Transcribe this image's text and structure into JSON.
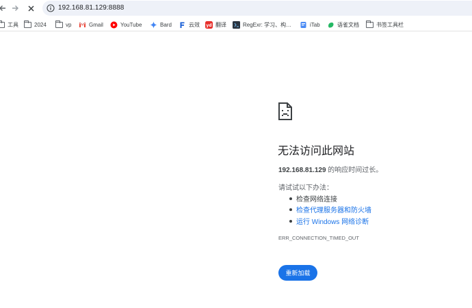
{
  "toolbar": {
    "back_icon": "arrow-back-icon",
    "forward_icon": "arrow-forward-icon",
    "stop_icon": "close-icon",
    "url": "192.168.81.129:8888"
  },
  "bookmarks": [
    {
      "label": "工具",
      "icon": "folder-icon"
    },
    {
      "label": "2024",
      "icon": "folder-icon"
    },
    {
      "label": "vp",
      "icon": "folder-icon"
    },
    {
      "label": "Gmail",
      "icon": "gmail-icon"
    },
    {
      "label": "YouTube",
      "icon": "youtube-icon"
    },
    {
      "label": "Bard",
      "icon": "bard-icon"
    },
    {
      "label": "云效",
      "icon": "yunxiao-icon"
    },
    {
      "label": "翻译",
      "icon": "youdao-icon"
    },
    {
      "label": "RegExr: 学习、构…",
      "icon": "regexr-icon"
    },
    {
      "label": "iTab",
      "icon": "itab-icon"
    },
    {
      "label": "语雀文档",
      "icon": "yuque-icon"
    },
    {
      "label": "书签工具栏",
      "icon": "folder-icon"
    }
  ],
  "error": {
    "icon": "sad-document-icon",
    "title": "无法访问此网站",
    "host": "192.168.81.129",
    "host_suffix": " 的响应时间过长。",
    "try_label": "请试试以下办法：",
    "suggestions": [
      "检查网络连接",
      "检查代理服务器和防火墙",
      "运行 Windows 网络诊断"
    ],
    "code": "ERR_CONNECTION_TIMED_OUT",
    "reload_label": "重新加载"
  },
  "colors": {
    "accent": "#1a73e8",
    "omnibox_bg": "#eef1f8",
    "text": "#202124",
    "muted": "#5f6368"
  }
}
